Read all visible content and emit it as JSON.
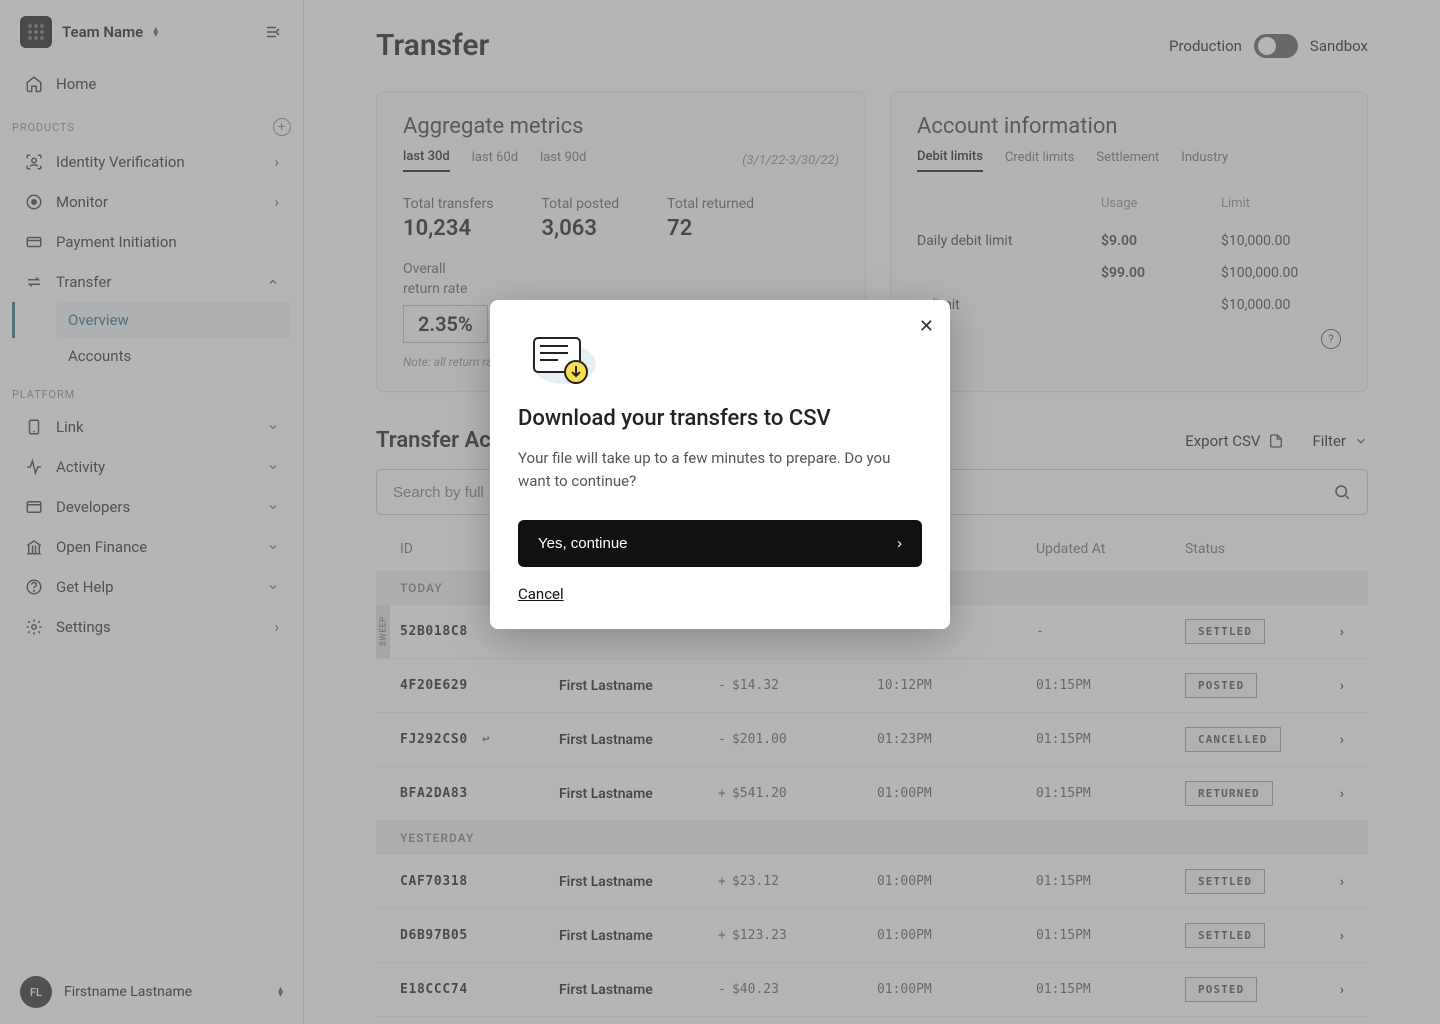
{
  "sidebar": {
    "team_name": "Team Name",
    "home": "Home",
    "products_label": "PRODUCTS",
    "platform_label": "PLATFORM",
    "products": {
      "identity": "Identity Verification",
      "monitor": "Monitor",
      "payment": "Payment Initiation",
      "transfer": "Transfer",
      "transfer_overview": "Overview",
      "transfer_accounts": "Accounts"
    },
    "platform": {
      "link": "Link",
      "activity": "Activity",
      "developers": "Developers",
      "open_finance": "Open Finance",
      "get_help": "Get Help",
      "settings": "Settings"
    },
    "user_initials": "FL",
    "user_name": "Firstname Lastname"
  },
  "header": {
    "title": "Transfer",
    "env_production": "Production",
    "env_sandbox": "Sandbox"
  },
  "aggregate": {
    "title": "Aggregate metrics",
    "tabs": {
      "t30": "last 30d",
      "t60": "last 60d",
      "t90": "last 90d"
    },
    "date_range": "(3/1/22-3/30/22)",
    "total_transfers_label": "Total transfers",
    "total_transfers": "10,234",
    "total_posted_label": "Total posted",
    "total_posted": "3,063",
    "total_returned_label": "Total returned",
    "total_returned": "72",
    "return_rate_label1": "Overall",
    "return_rate_label2": "return rate",
    "return_rate": "2.35%",
    "note": "Note: all return ra"
  },
  "account": {
    "title": "Account information",
    "tabs": {
      "debit": "Debit limits",
      "credit": "Credit limits",
      "settlement": "Settlement",
      "industry": "Industry"
    },
    "usage_header": "Usage",
    "limit_header": "Limit",
    "rows": [
      {
        "name": "Daily debit limit",
        "usage": "$9.00",
        "limit": "$10,000.00"
      },
      {
        "name": "",
        "usage": "$99.00",
        "limit": "$100,000.00"
      },
      {
        "name": "er limit",
        "usage": "",
        "limit": "$10,000.00"
      }
    ]
  },
  "activity": {
    "title": "Transfer Activi",
    "export": "Export CSV",
    "filter": "Filter",
    "search_placeholder": "Search by full",
    "columns": {
      "id": "ID",
      "updated": "Updated At",
      "status": "Status"
    },
    "group_today": "TODAY",
    "group_yesterday": "YESTERDAY",
    "rows": [
      {
        "id": "52B018C8",
        "sweep": "SWEEP",
        "acct": "",
        "sign": "",
        "amount": "",
        "created": "",
        "updated": "-",
        "status": "SETTLED"
      },
      {
        "id": "4F20E629",
        "acct": "First Lastname",
        "sign": "-",
        "amount": "$14.32",
        "created": "10:12PM",
        "updated": "01:15PM",
        "status": "POSTED"
      },
      {
        "id": "FJ292CS0",
        "ret": true,
        "acct": "First Lastname",
        "sign": "-",
        "amount": "$201.00",
        "created": "01:23PM",
        "updated": "01:15PM",
        "status": "CANCELLED"
      },
      {
        "id": "BFA2DA83",
        "acct": "First Lastname",
        "sign": "+",
        "amount": "$541.20",
        "created": "01:00PM",
        "updated": "01:15PM",
        "status": "RETURNED"
      }
    ],
    "rows_yesterday": [
      {
        "id": "CAF70318",
        "acct": "First Lastname",
        "sign": "+",
        "amount": "$23.12",
        "created": "01:00PM",
        "updated": "01:15PM",
        "status": "SETTLED"
      },
      {
        "id": "D6B97B05",
        "acct": "First Lastname",
        "sign": "+",
        "amount": "$123.23",
        "created": "01:00PM",
        "updated": "01:15PM",
        "status": "SETTLED"
      },
      {
        "id": "E18CCC74",
        "acct": "First Lastname",
        "sign": "-",
        "amount": "$40.23",
        "created": "01:00PM",
        "updated": "01:15PM",
        "status": "POSTED"
      }
    ]
  },
  "modal": {
    "title": "Download your transfers to CSV",
    "body": "Your file will take up to a few minutes to prepare. Do you want to continue?",
    "primary": "Yes, continue",
    "cancel": "Cancel"
  }
}
